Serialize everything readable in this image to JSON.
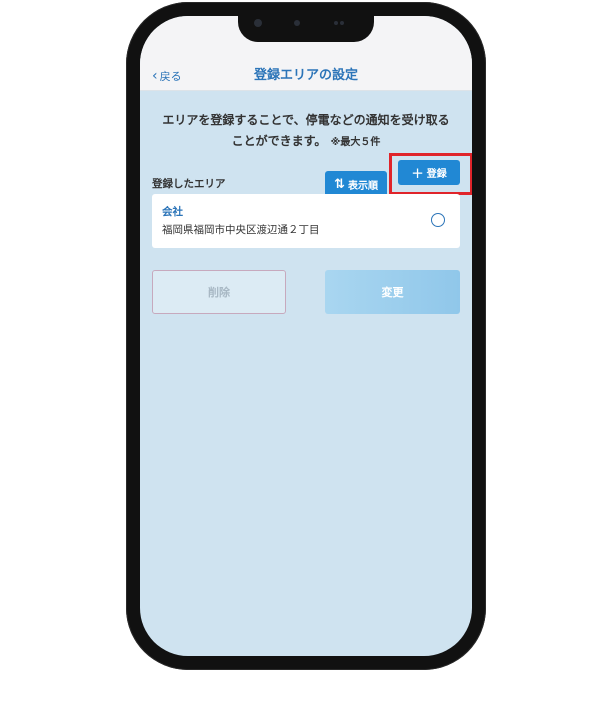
{
  "header": {
    "back_label": "戻る",
    "title": "登録エリアの設定"
  },
  "description": {
    "line1": "エリアを登録することで、停電などの通知を受け取る",
    "line2": "ことができます。",
    "note": "※最大５件"
  },
  "section": {
    "label": "登録したエリア",
    "sort_label": "表示順",
    "add_label": "登録"
  },
  "areas": [
    {
      "name": "会社",
      "address": "福岡県福岡市中央区渡辺通２丁目"
    }
  ],
  "actions": {
    "delete_label": "削除",
    "change_label": "変更"
  },
  "colors": {
    "accent": "#2188d4",
    "highlight": "#e0242a",
    "background": "#cfe3f0"
  }
}
